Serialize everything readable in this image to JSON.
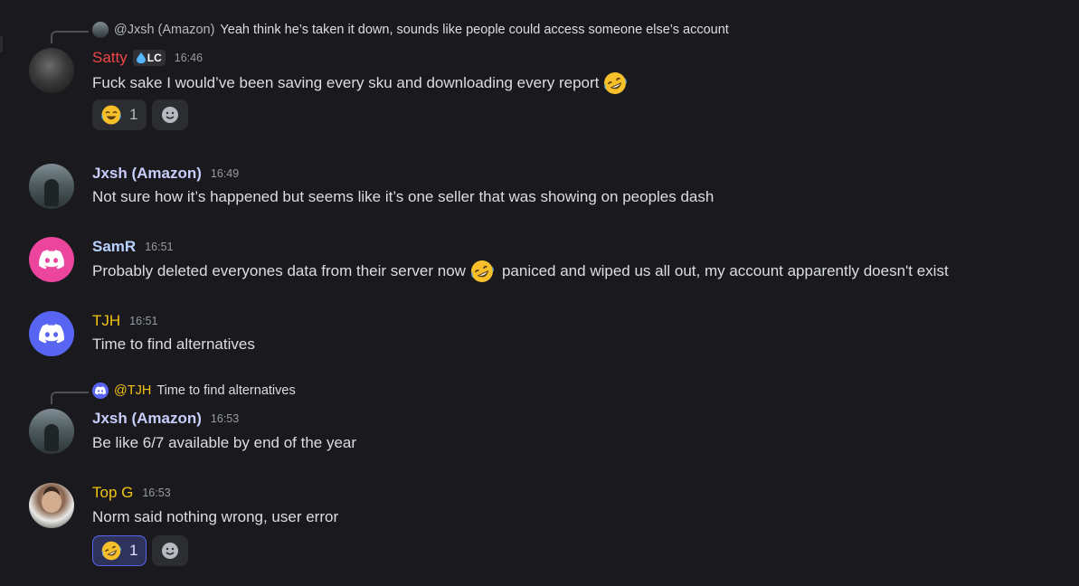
{
  "messages": [
    {
      "reply": {
        "author": "@Jxsh (Amazon)",
        "text": "Yeah think he’s taken it down, sounds like people could access someone else’s account",
        "avatar_icon": "user-avatar-icon"
      },
      "author": "Satty",
      "author_color": "#f04747",
      "tag": "LC",
      "time": "16:46",
      "text": "Fuck sake I would’ve been saving every sku and downloading every report",
      "reactions": [
        {
          "emoji": "joy-emoji",
          "count": "1",
          "selected": false
        }
      ]
    },
    {
      "author": "Jxsh (Amazon)",
      "time": "16:49",
      "text": "Not sure how it’s happened but seems like it’s one seller that was showing on peoples dash"
    },
    {
      "author": "SamR",
      "time": "16:51",
      "text_before": "Probably deleted everyones data from their server now",
      "text_after": "paniced and wiped us all out, my account apparently doesn't exist",
      "avatar_color": "#eb459e"
    },
    {
      "author": "TJH",
      "author_color": "#f1c40f",
      "time": "16:51",
      "text": "Time to find alternatives",
      "avatar_color": "#5865f2"
    },
    {
      "reply": {
        "author": "@TJH",
        "text": "Time to find alternatives",
        "avatar_icon": "discord-logo-icon"
      },
      "author": "Jxsh (Amazon)",
      "time": "16:53",
      "text": "Be like 6/7 available by end of the year"
    },
    {
      "author": "Top G",
      "author_color": "#f1c40f",
      "time": "16:53",
      "text": "Norm said nothing wrong, user error",
      "reactions": [
        {
          "emoji": "rofl-emoji",
          "count": "1",
          "selected": true
        }
      ]
    }
  ],
  "colors": {
    "background": "#1a1a1e",
    "accent": "#5865f2",
    "text": "#dbdee1",
    "muted": "#949ba4"
  }
}
